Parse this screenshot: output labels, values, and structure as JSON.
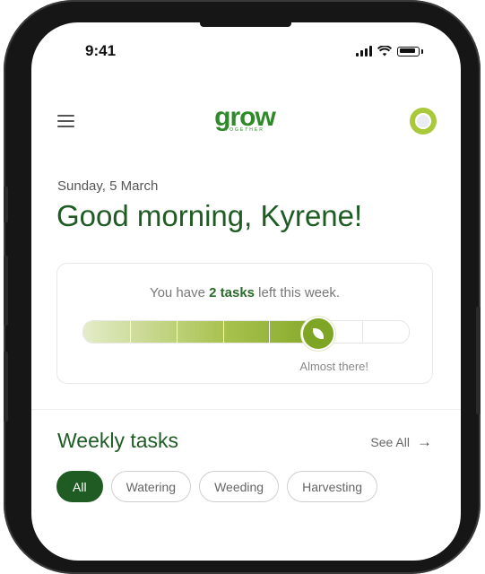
{
  "status_bar": {
    "time": "9:41"
  },
  "brand": {
    "name": "grow",
    "tagline": "TOGETHER",
    "color": "#2f8a2a"
  },
  "header": {
    "menu_icon": "hamburger-icon",
    "avatar_icon": "avatar-icon"
  },
  "main": {
    "date": "Sunday, 5 March",
    "greeting": "Good morning, Kyrene!"
  },
  "progress": {
    "prefix": "You have ",
    "count_text": "2 tasks",
    "suffix": " left this week.",
    "status": "Almost there!",
    "segments_total": 7,
    "segments_done": 5,
    "fill_fraction": 0.72,
    "icon": "leaf-icon"
  },
  "weekly_tasks": {
    "title": "Weekly tasks",
    "see_all": "See All",
    "filters": [
      {
        "label": "All",
        "active": true
      },
      {
        "label": "Watering",
        "active": false
      },
      {
        "label": "Weeding",
        "active": false
      },
      {
        "label": "Harvesting",
        "active": false
      }
    ]
  },
  "colors": {
    "primary": "#1f5c24",
    "accent": "#7ea624"
  }
}
